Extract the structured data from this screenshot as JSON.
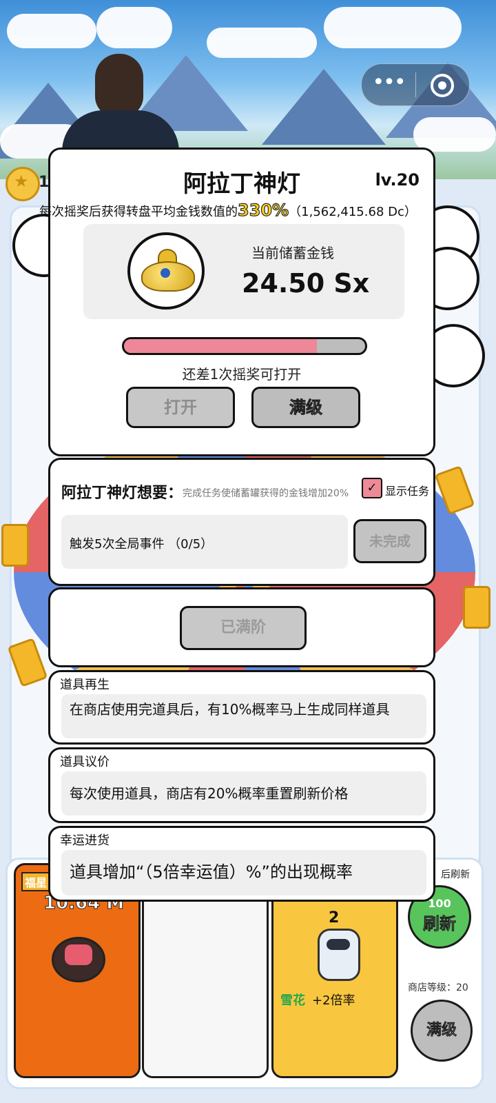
{
  "top": {
    "coin_count_visible": "1",
    "capsule_more_glyph": "•••"
  },
  "main_panel": {
    "title": "阿拉丁神灯",
    "level": "lv.20",
    "desc_prefix": "每次摇奖后获得转盘平均金钱数值的",
    "desc_percent": "330%",
    "desc_suffix": "（1,562,415.68 Dc）",
    "savings_label": "当前储蓄金钱",
    "savings_value": "24.50 Sx",
    "progress_fraction": 0.8,
    "remaining_text": "还差1次摇奖可打开",
    "open_button": "打开",
    "max_level_button": "满级"
  },
  "wants_panel": {
    "title": "阿拉丁神灯想要：",
    "subtitle": "完成任务使储蓄罐获得的金钱增加20%",
    "show_task_checked": true,
    "show_task_label": "显示任务",
    "check_glyph": "✓",
    "task_text": "触发5次全局事件 （0/5）",
    "incomplete_button": "未完成"
  },
  "tier_panel": {
    "maxed_tier_button": "已满阶"
  },
  "perks": [
    {
      "title": "道具再生",
      "description": "在商店使用完道具后，有10%概率马上生成同样道具"
    },
    {
      "title": "道具议价",
      "description": "每次使用道具，商店有20%概率重置刷新价格"
    },
    {
      "title": "幸运进货",
      "description": "道具增加“（5倍幸运值）%”的出现概率"
    }
  ],
  "shop": {
    "card1_tag": "福星",
    "card1_price": "10.64 M",
    "card3_level": "2",
    "card3_tag": "雪花",
    "card3_bonus": "+2倍率",
    "refresh_corner_text": "后刷新",
    "refresh_count": "100",
    "refresh_label": "刷新",
    "shop_level_text": "商店等级：20",
    "shop_max_button": "满级"
  },
  "colors": {
    "progress_fill": "#ee8898",
    "percent_highlight": "#ffd21c",
    "card_orange": "#ec6b13",
    "card_yellow": "#f9c640",
    "refresh_green": "#58c45c"
  }
}
